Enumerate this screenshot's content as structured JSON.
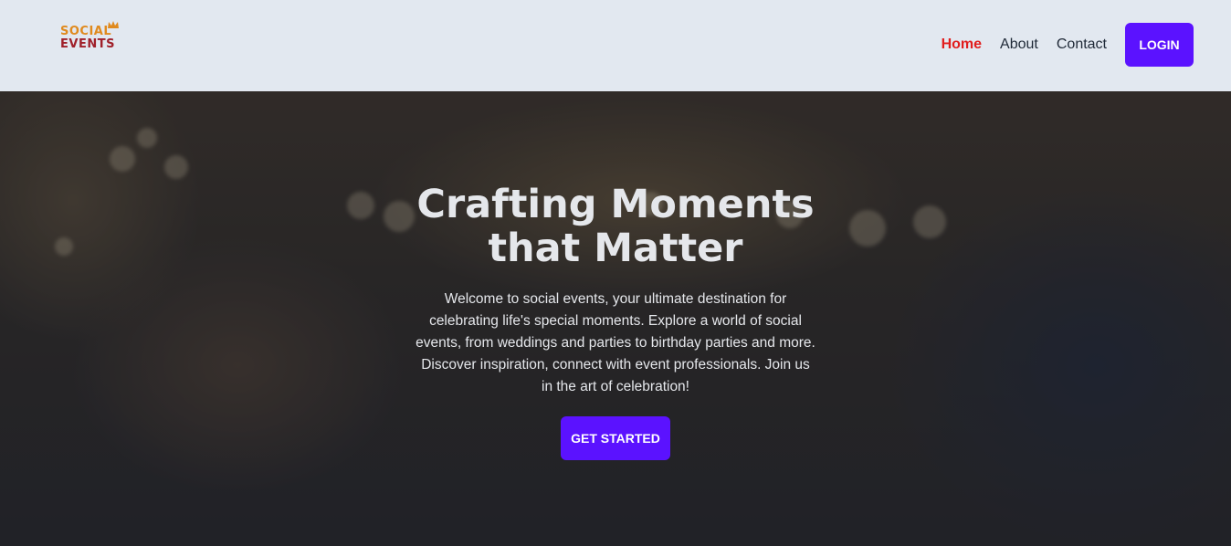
{
  "brand": {
    "line1": "SOCIAL",
    "line2": "EVENTS",
    "colors": {
      "primary": "#e08a1e",
      "secondary": "#a0202a"
    }
  },
  "nav": {
    "items": [
      {
        "label": "Home",
        "active": true
      },
      {
        "label": "About",
        "active": false
      },
      {
        "label": "Contact",
        "active": false
      }
    ],
    "login_label": "LOGIN"
  },
  "hero": {
    "title": "Crafting Moments that Matter",
    "description": "Welcome to social events, your ultimate destination for celebrating life's special moments. Explore a world of social events, from weddings and parties to birthday parties and more. Discover inspiration, connect with event professionals. Join us in the art of celebration!",
    "cta_label": "GET STARTED"
  },
  "colors": {
    "nav_background": "#e2e8f0",
    "accent": "#5b12ff",
    "active_link": "#e11d1d"
  }
}
